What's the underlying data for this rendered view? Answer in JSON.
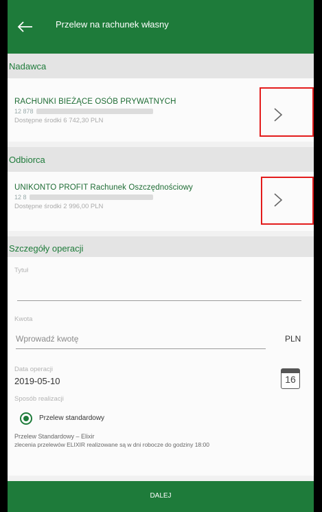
{
  "header": {
    "title": "Przelew na rachunek własny",
    "back_icon": "arrow-left-icon"
  },
  "sender": {
    "section_label": "Nadawca",
    "account_name": "RACHUNKI BIEŻĄCE OSÓB PRYWATNYCH",
    "account_number_prefix": "12 878",
    "balance_text": "Dostępne środki 6 742,30 PLN"
  },
  "recipient": {
    "section_label": "Odbiorca",
    "account_name": "UNIKONTO PROFIT Rachunek Oszczędnościowy",
    "account_number_prefix": "12 8",
    "balance_text": "Dostępne środki 2 996,00 PLN"
  },
  "details": {
    "section_label": "Szczegóły operacji",
    "title_label": "Tytuł",
    "title_value": "",
    "amount_label": "Kwota",
    "amount_placeholder": "Wprowadź kwotę",
    "currency": "PLN",
    "date_label": "Data operacji",
    "date_value": "2019-05-10",
    "calendar_day": "16",
    "method_label": "Sposób realizacji",
    "method_option": "Przelew standardowy",
    "note_line1": "Przelew Standardowy – Elixir",
    "note_line2": "zlecenia przelewów ELIXIR realizowane są w dni robocze do godziny 18:00"
  },
  "footer": {
    "next_button": "DALEJ"
  },
  "colors": {
    "brand_green": "#1e7b3a",
    "highlight_red": "#e31b1b"
  }
}
